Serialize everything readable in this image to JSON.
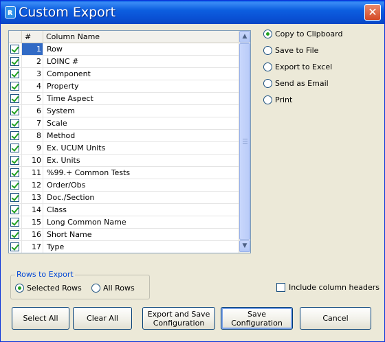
{
  "window": {
    "title": "Custom Export",
    "icon": "loinc-app-icon",
    "close_symbol": "✕"
  },
  "grid": {
    "header_num": "#",
    "header_name": "Column Name",
    "selected_row": 1,
    "rows": [
      {
        "n": "1",
        "name": "Row"
      },
      {
        "n": "2",
        "name": "LOINC #"
      },
      {
        "n": "3",
        "name": "Component"
      },
      {
        "n": "4",
        "name": "Property"
      },
      {
        "n": "5",
        "name": "Time Aspect"
      },
      {
        "n": "6",
        "name": "System"
      },
      {
        "n": "7",
        "name": "Scale"
      },
      {
        "n": "8",
        "name": "Method"
      },
      {
        "n": "9",
        "name": "Ex. UCUM Units"
      },
      {
        "n": "10",
        "name": "Ex. Units"
      },
      {
        "n": "11",
        "name": "%99.+ Common Tests"
      },
      {
        "n": "12",
        "name": "Order/Obs"
      },
      {
        "n": "13",
        "name": "Doc./Section"
      },
      {
        "n": "14",
        "name": "Class"
      },
      {
        "n": "15",
        "name": "Long Common Name"
      },
      {
        "n": "16",
        "name": "Short Name"
      },
      {
        "n": "17",
        "name": "Type"
      }
    ]
  },
  "export_options": {
    "items": [
      {
        "label": "Copy to Clipboard",
        "selected": true
      },
      {
        "label": "Save to File",
        "selected": false
      },
      {
        "label": "Export to Excel",
        "selected": false
      },
      {
        "label": "Send as Email",
        "selected": false
      },
      {
        "label": "Print",
        "selected": false
      }
    ]
  },
  "rows_to_export": {
    "legend": "Rows to Export",
    "selected_rows": "Selected Rows",
    "all_rows": "All Rows"
  },
  "include_headers": "Include column headers",
  "buttons": {
    "select_all": "Select All",
    "clear_all": "Clear All",
    "export_save_line1": "Export and Save",
    "export_save_line2": "Configuration",
    "save_config": "Save Configuration",
    "cancel": "Cancel"
  },
  "colors": {
    "title_bar": "#0a52d6",
    "selection": "#316ac5",
    "check": "#21a121",
    "legend": "#0046d5"
  }
}
